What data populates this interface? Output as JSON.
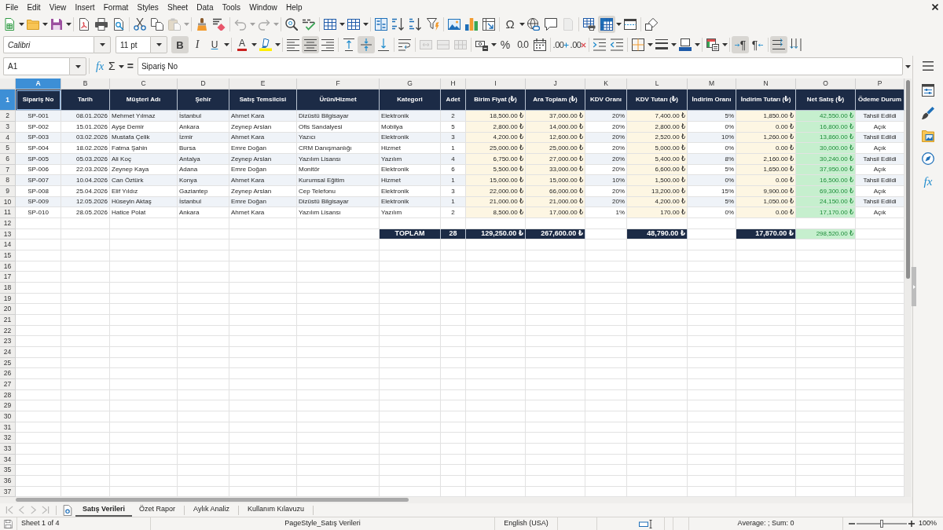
{
  "menu": [
    "File",
    "Edit",
    "View",
    "Insert",
    "Format",
    "Styles",
    "Sheet",
    "Data",
    "Tools",
    "Window",
    "Help"
  ],
  "toolbar_standard": [
    [
      {
        "kind": "new_spreadsheet",
        "pressed": false,
        "disabled": false,
        "dropdown": true
      },
      {
        "kind": "open",
        "pressed": false,
        "disabled": false,
        "dropdown": true
      },
      {
        "kind": "save",
        "pressed": false,
        "disabled": false,
        "dropdown": true
      }
    ],
    [
      {
        "kind": "export_pdf",
        "pressed": false,
        "disabled": false,
        "dropdown": false
      },
      {
        "kind": "print",
        "pressed": false,
        "disabled": false,
        "dropdown": false
      },
      {
        "kind": "print_preview",
        "pressed": false,
        "disabled": false,
        "dropdown": false
      }
    ],
    [
      {
        "kind": "cut",
        "pressed": false,
        "disabled": false,
        "dropdown": false
      },
      {
        "kind": "copy",
        "pressed": false,
        "disabled": false,
        "dropdown": false
      },
      {
        "kind": "paste",
        "pressed": false,
        "disabled": true,
        "dropdown": true
      }
    ],
    [
      {
        "kind": "clone_formatting",
        "pressed": false,
        "disabled": false,
        "dropdown": false
      },
      {
        "kind": "clear_formatting",
        "pressed": false,
        "disabled": false,
        "dropdown": false
      }
    ],
    [
      {
        "kind": "undo",
        "pressed": false,
        "disabled": true,
        "dropdown": true
      },
      {
        "kind": "redo",
        "pressed": false,
        "disabled": true,
        "dropdown": true
      }
    ],
    [
      {
        "kind": "find_replace",
        "pressed": false,
        "disabled": false,
        "dropdown": false
      },
      {
        "kind": "spelling",
        "pressed": false,
        "disabled": false,
        "dropdown": false
      }
    ],
    [
      {
        "kind": "rows",
        "pressed": false,
        "disabled": false,
        "dropdown": true
      },
      {
        "kind": "columns",
        "pressed": false,
        "disabled": false,
        "dropdown": true
      }
    ],
    [
      {
        "kind": "sort",
        "pressed": false,
        "disabled": false,
        "dropdown": false
      },
      {
        "kind": "sort_ascending",
        "pressed": false,
        "disabled": false,
        "dropdown": false
      },
      {
        "kind": "sort_descending",
        "pressed": false,
        "disabled": false,
        "dropdown": false
      },
      {
        "kind": "autofilter",
        "pressed": false,
        "disabled": false,
        "dropdown": false
      }
    ],
    [
      {
        "kind": "image",
        "pressed": false,
        "disabled": false,
        "dropdown": false
      },
      {
        "kind": "chart",
        "pressed": false,
        "disabled": false,
        "dropdown": false
      },
      {
        "kind": "pivot_table",
        "pressed": false,
        "disabled": false,
        "dropdown": false
      }
    ],
    [
      {
        "kind": "special_character",
        "label": "Ω",
        "pressed": false,
        "disabled": false,
        "dropdown": true
      },
      {
        "kind": "hyperlink",
        "pressed": false,
        "disabled": false,
        "dropdown": false
      },
      {
        "kind": "comment",
        "pressed": false,
        "disabled": false,
        "dropdown": false
      },
      {
        "kind": "header_footer",
        "pressed": false,
        "disabled": true,
        "dropdown": false
      }
    ],
    [
      {
        "kind": "print_range",
        "pressed": false,
        "disabled": false,
        "dropdown": false
      },
      {
        "kind": "freeze",
        "pressed": true,
        "disabled": false,
        "dropdown": true
      },
      {
        "kind": "split_window",
        "pressed": false,
        "disabled": false,
        "dropdown": false
      }
    ],
    [
      {
        "kind": "shapes",
        "pressed": false,
        "disabled": false,
        "dropdown": false
      }
    ]
  ],
  "font_name": {
    "value": "Calibri"
  },
  "font_size": {
    "value": "11 pt"
  },
  "toolbar_formatting": [
    [
      {
        "kind": "bold",
        "label": "B",
        "pressed": true,
        "disabled": false,
        "dropdown": false
      },
      {
        "kind": "italic",
        "label": "I",
        "pressed": false,
        "disabled": false,
        "dropdown": false
      },
      {
        "kind": "underline",
        "label": "U",
        "pressed": false,
        "disabled": false,
        "dropdown": true
      }
    ],
    [
      {
        "kind": "font_color",
        "label": "A",
        "pressed": false,
        "disabled": false,
        "dropdown": true
      },
      {
        "kind": "highlight",
        "pressed": false,
        "disabled": false,
        "dropdown": true
      }
    ],
    [
      {
        "kind": "align_left",
        "pressed": false,
        "disabled": false,
        "dropdown": false
      },
      {
        "kind": "align_center",
        "pressed": true,
        "disabled": false,
        "dropdown": false
      },
      {
        "kind": "align_right",
        "pressed": false,
        "disabled": false,
        "dropdown": false
      }
    ],
    [
      {
        "kind": "align_top",
        "pressed": false,
        "disabled": false,
        "dropdown": false
      },
      {
        "kind": "align_middle",
        "pressed": true,
        "disabled": false,
        "dropdown": false
      },
      {
        "kind": "align_bottom",
        "pressed": false,
        "disabled": false,
        "dropdown": false
      }
    ],
    [
      {
        "kind": "wrap_text",
        "pressed": false,
        "disabled": false,
        "dropdown": false
      }
    ],
    [
      {
        "kind": "merge_center",
        "pressed": false,
        "disabled": true,
        "dropdown": false
      },
      {
        "kind": "merge",
        "pressed": false,
        "disabled": true,
        "dropdown": false
      },
      {
        "kind": "unmerge",
        "pressed": false,
        "disabled": true,
        "dropdown": false
      }
    ],
    [
      {
        "kind": "currency",
        "pressed": false,
        "disabled": false,
        "dropdown": true
      },
      {
        "kind": "percent",
        "label": "%",
        "pressed": false,
        "disabled": false,
        "dropdown": false
      },
      {
        "kind": "number",
        "label": "0.0",
        "pressed": false,
        "disabled": false,
        "dropdown": false
      },
      {
        "kind": "date",
        "pressed": false,
        "disabled": false,
        "dropdown": false
      }
    ],
    [
      {
        "kind": "add_decimal",
        "label": ".00",
        "pressed": false,
        "disabled": false,
        "dropdown": false
      },
      {
        "kind": "delete_decimal",
        "label": ".00",
        "pressed": false,
        "disabled": false,
        "dropdown": false
      }
    ],
    [
      {
        "kind": "indent_increase",
        "pressed": false,
        "disabled": false,
        "dropdown": false
      },
      {
        "kind": "indent_decrease",
        "pressed": false,
        "disabled": false,
        "dropdown": false
      }
    ],
    [
      {
        "kind": "borders",
        "pressed": false,
        "disabled": false,
        "dropdown": true
      },
      {
        "kind": "border_style",
        "pressed": false,
        "disabled": false,
        "dropdown": true
      },
      {
        "kind": "border_color",
        "pressed": false,
        "disabled": false,
        "dropdown": true
      }
    ],
    [
      {
        "kind": "conditional",
        "pressed": false,
        "disabled": false,
        "dropdown": true
      }
    ],
    [
      {
        "kind": "ltr",
        "label": "¶",
        "pressed": true,
        "disabled": false,
        "dropdown": false
      },
      {
        "kind": "rtl",
        "label": "¶",
        "pressed": false,
        "disabled": false,
        "dropdown": false
      }
    ],
    [
      {
        "kind": "text_horizontal",
        "pressed": true,
        "disabled": false,
        "dropdown": false
      },
      {
        "kind": "text_vertical",
        "pressed": false,
        "disabled": false,
        "dropdown": false
      }
    ]
  ],
  "formula_bar": {
    "name_box": "A1",
    "function_wizard": "fx",
    "sum": "Σ",
    "formula": "=",
    "content": "Sipariş No"
  },
  "sidebar": [
    {
      "kind": "menu"
    },
    {
      "kind": "properties"
    },
    {
      "kind": "styles"
    },
    {
      "kind": "gallery"
    },
    {
      "kind": "navigator"
    },
    {
      "kind": "functions",
      "label": "fx"
    }
  ],
  "sheet": {
    "columns": [
      {
        "label": "A",
        "selected": true
      },
      {
        "label": "B",
        "selected": false
      },
      {
        "label": "C",
        "selected": false
      },
      {
        "label": "D",
        "selected": false
      },
      {
        "label": "E",
        "selected": false
      },
      {
        "label": "F",
        "selected": false
      },
      {
        "label": "G",
        "selected": false
      },
      {
        "label": "H",
        "selected": false
      },
      {
        "label": "I",
        "selected": false
      },
      {
        "label": "J",
        "selected": false
      },
      {
        "label": "K",
        "selected": false
      },
      {
        "label": "L",
        "selected": false
      },
      {
        "label": "M",
        "selected": false
      },
      {
        "label": "N",
        "selected": false
      },
      {
        "label": "O",
        "selected": false
      },
      {
        "label": "P",
        "selected": false
      }
    ],
    "row_numbers": [
      {
        "label": "1",
        "selected": true
      },
      {
        "label": "2",
        "selected": false
      },
      {
        "label": "3",
        "selected": false
      },
      {
        "label": "4",
        "selected": false
      },
      {
        "label": "5",
        "selected": false
      },
      {
        "label": "6",
        "selected": false
      },
      {
        "label": "7",
        "selected": false
      },
      {
        "label": "8",
        "selected": false
      },
      {
        "label": "9",
        "selected": false
      },
      {
        "label": "10",
        "selected": false
      },
      {
        "label": "11",
        "selected": false
      },
      {
        "label": "12",
        "selected": false
      },
      {
        "label": "13",
        "selected": false
      },
      {
        "label": "14",
        "selected": false
      },
      {
        "label": "15",
        "selected": false
      },
      {
        "label": "16",
        "selected": false
      },
      {
        "label": "17",
        "selected": false
      },
      {
        "label": "18",
        "selected": false
      },
      {
        "label": "19",
        "selected": false
      },
      {
        "label": "20",
        "selected": false
      },
      {
        "label": "21",
        "selected": false
      },
      {
        "label": "22",
        "selected": false
      },
      {
        "label": "23",
        "selected": false
      },
      {
        "label": "24",
        "selected": false
      },
      {
        "label": "25",
        "selected": false
      },
      {
        "label": "26",
        "selected": false
      },
      {
        "label": "27",
        "selected": false
      },
      {
        "label": "28",
        "selected": false
      },
      {
        "label": "29",
        "selected": false
      },
      {
        "label": "30",
        "selected": false
      },
      {
        "label": "31",
        "selected": false
      },
      {
        "label": "32",
        "selected": false
      },
      {
        "label": "33",
        "selected": false
      },
      {
        "label": "34",
        "selected": false
      },
      {
        "label": "35",
        "selected": false
      },
      {
        "label": "36",
        "selected": false
      },
      {
        "label": "37",
        "selected": false
      }
    ],
    "header": [
      "Sipariş No",
      "Tarih",
      "Müşteri Adı",
      "Şehir",
      "Satış Temsilcisi",
      "Ürün/Hizmet",
      "Kategori",
      "Adet",
      "Birim Fiyat (₺)",
      "Ara Toplam (₺)",
      "KDV Oranı",
      "KDV Tutarı (₺)",
      "İndirim Oranı",
      "İndirim Tutarı (₺)",
      "Net Satış (₺)",
      "Ödeme Durum"
    ],
    "records": [
      [
        "SP-001",
        "08.01.2026",
        "Mehmet Yılmaz",
        "İstanbul",
        "Ahmet Kara",
        "Dizüstü Bilgisayar",
        "Elektronik",
        "2",
        "18,500.00 ₺",
        "37,000.00 ₺",
        "20%",
        "7,400.00 ₺",
        "5%",
        "1,850.00 ₺",
        "42,550.00 ₺",
        "Tahsil Edildi"
      ],
      [
        "SP-002",
        "15.01.2026",
        "Ayşe Demir",
        "Ankara",
        "Zeynep Arslan",
        "Ofis Sandalyesi",
        "Mobilya",
        "5",
        "2,800.00 ₺",
        "14,000.00 ₺",
        "20%",
        "2,800.00 ₺",
        "0%",
        "0.00 ₺",
        "16,800.00 ₺",
        "Açık"
      ],
      [
        "SP-003",
        "03.02.2026",
        "Mustafa Çelik",
        "İzmir",
        "Ahmet Kara",
        "Yazıcı",
        "Elektronik",
        "3",
        "4,200.00 ₺",
        "12,600.00 ₺",
        "20%",
        "2,520.00 ₺",
        "10%",
        "1,260.00 ₺",
        "13,860.00 ₺",
        "Tahsil Edildi"
      ],
      [
        "SP-004",
        "18.02.2026",
        "Fatma Şahin",
        "Bursa",
        "Emre Doğan",
        "CRM Danışmanlığı",
        "Hizmet",
        "1",
        "25,000.00 ₺",
        "25,000.00 ₺",
        "20%",
        "5,000.00 ₺",
        "0%",
        "0.00 ₺",
        "30,000.00 ₺",
        "Açık"
      ],
      [
        "SP-005",
        "05.03.2026",
        "Ali Koç",
        "Antalya",
        "Zeynep Arslan",
        "Yazılım Lisansı",
        "Yazılım",
        "4",
        "6,750.00 ₺",
        "27,000.00 ₺",
        "20%",
        "5,400.00 ₺",
        "8%",
        "2,160.00 ₺",
        "30,240.00 ₺",
        "Tahsil Edildi"
      ],
      [
        "SP-006",
        "22.03.2026",
        "Zeynep Kaya",
        "Adana",
        "Emre Doğan",
        "Monitör",
        "Elektronik",
        "6",
        "5,500.00 ₺",
        "33,000.00 ₺",
        "20%",
        "6,600.00 ₺",
        "5%",
        "1,650.00 ₺",
        "37,950.00 ₺",
        "Açık"
      ],
      [
        "SP-007",
        "10.04.2026",
        "Can Öztürk",
        "Konya",
        "Ahmet Kara",
        "Kurumsal Eğitim",
        "Hizmet",
        "1",
        "15,000.00 ₺",
        "15,000.00 ₺",
        "10%",
        "1,500.00 ₺",
        "0%",
        "0.00 ₺",
        "16,500.00 ₺",
        "Tahsil Edildi"
      ],
      [
        "SP-008",
        "25.04.2026",
        "Elif Yıldız",
        "Gaziantep",
        "Zeynep Arslan",
        "Cep Telefonu",
        "Elektronik",
        "3",
        "22,000.00 ₺",
        "66,000.00 ₺",
        "20%",
        "13,200.00 ₺",
        "15%",
        "9,900.00 ₺",
        "69,300.00 ₺",
        "Açık"
      ],
      [
        "SP-009",
        "12.05.2026",
        "Hüseyin Aktaş",
        "İstanbul",
        "Emre Doğan",
        "Dizüstü Bilgisayar",
        "Elektronik",
        "1",
        "21,000.00 ₺",
        "21,000.00 ₺",
        "20%",
        "4,200.00 ₺",
        "5%",
        "1,050.00 ₺",
        "24,150.00 ₺",
        "Tahsil Edildi"
      ],
      [
        "SP-010",
        "28.05.2026",
        "Hatice Polat",
        "Ankara",
        "Ahmet Kara",
        "Yazılım Lisansı",
        "Yazılım",
        "2",
        "8,500.00 ₺",
        "17,000.00 ₺",
        "1%",
        "170.00 ₺",
        "0%",
        "0.00 ₺",
        "17,170.00 ₺",
        "Açık"
      ]
    ],
    "totals": {
      "label": "TOPLAM",
      "quantity": "28",
      "unit_price": "129,250.00 ₺",
      "subtotal": "267,600.00 ₺",
      "vat_amount": "48,790.00 ₺",
      "discount_amount": "17,870.00 ₺",
      "net_sales": "298,520.00 ₺"
    }
  },
  "tab_navigation": [
    {
      "kind": "first",
      "disabled": true
    },
    {
      "kind": "previous",
      "disabled": true
    },
    {
      "kind": "next",
      "disabled": true
    },
    {
      "kind": "last",
      "disabled": true
    },
    {
      "kind": "add_sheet",
      "disabled": false
    }
  ],
  "sheet_tabs": [
    {
      "label": "Satış Verileri",
      "selected": true
    },
    {
      "label": "Özet Rapor",
      "selected": false
    },
    {
      "label": "Aylık Analiz",
      "selected": false
    },
    {
      "label": "Kullanım Kılavuzu",
      "selected": false
    }
  ],
  "status_bar": {
    "sheet": "Sheet 1 of 4",
    "page_style": "PageStyle_Satış Verileri",
    "language": "English (USA)",
    "selection_sum": "Average: ; Sum: 0",
    "zoom": {
      "level": 0.5,
      "reading": "100%"
    }
  }
}
